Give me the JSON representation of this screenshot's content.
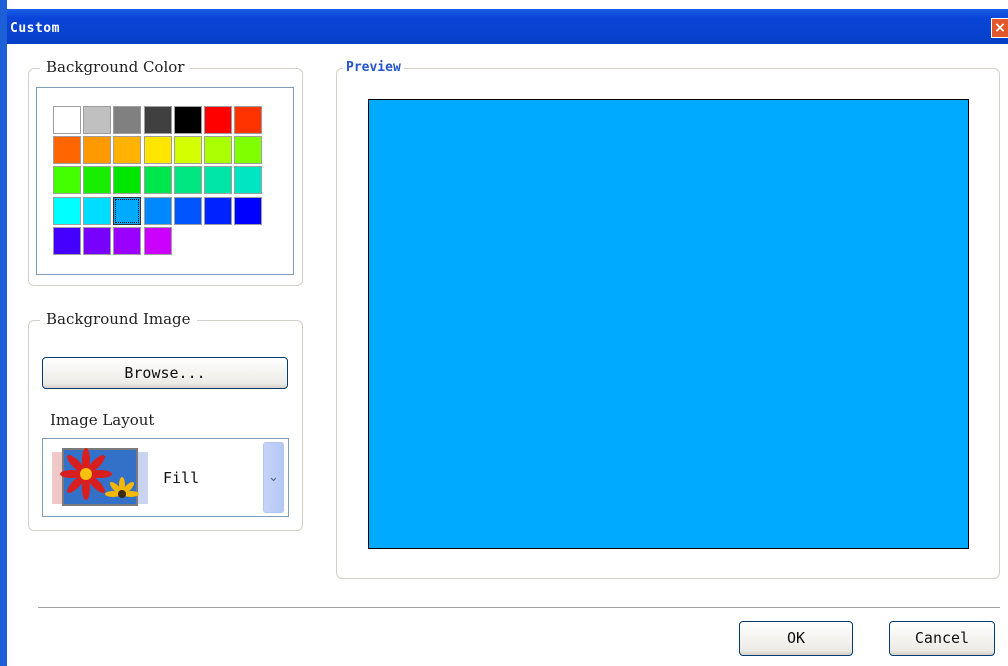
{
  "window": {
    "title": "Custom",
    "close_glyph": "×"
  },
  "background_color": {
    "legend": "Background Color",
    "selected_index": 23,
    "swatches": [
      "#ffffff",
      "#c0c0c0",
      "#808080",
      "#404040",
      "#000000",
      "#ff0000",
      "#ff3300",
      "#ff6600",
      "#ff9900",
      "#ffb300",
      "#ffe600",
      "#d4ff00",
      "#aaff00",
      "#80ff00",
      "#44ff00",
      "#1aee00",
      "#00e600",
      "#00e64d",
      "#00e680",
      "#00e6a8",
      "#00e6c2",
      "#00ffff",
      "#00ddff",
      "#00aaff",
      "#0088ff",
      "#0055ff",
      "#0022ff",
      "#0000ff",
      "#4400ff",
      "#7700ff",
      "#9900ff",
      "#cc00ff"
    ]
  },
  "background_image": {
    "legend": "Background Image",
    "browse_label": "Browse...",
    "layout_label": "Image Layout",
    "layout_value": "Fill",
    "dropdown_icon": "chevron-down-icon"
  },
  "preview": {
    "legend": "Preview",
    "color": "#00aaff"
  },
  "footer": {
    "ok_label": "OK",
    "cancel_label": "Cancel"
  }
}
